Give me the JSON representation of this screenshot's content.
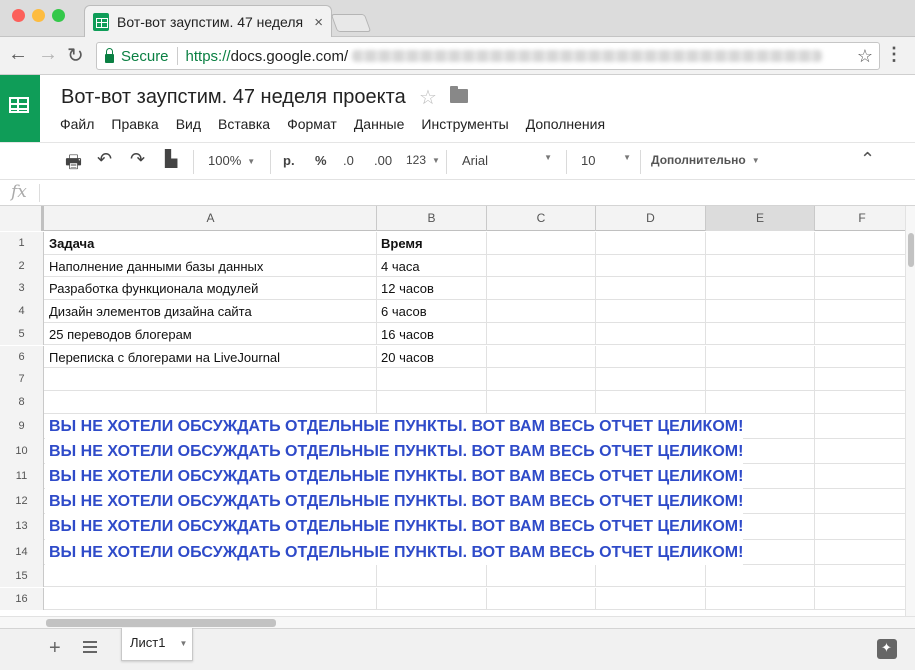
{
  "browser": {
    "tab_title": "Вот-вот заупстим. 47 неделя",
    "tab_close": "×",
    "secure_label": "Secure",
    "url_protocol": "https://",
    "url_host": "docs.google.com/"
  },
  "doc": {
    "title": "Вот-вот заупстим. 47 неделя проекта",
    "menu": [
      "Файл",
      "Правка",
      "Вид",
      "Вставка",
      "Формат",
      "Данные",
      "Инструменты",
      "Дополнения"
    ]
  },
  "toolbar": {
    "zoom": "100%",
    "currency": "р.",
    "percent": "%",
    "dec_decrease": ".0",
    "dec_increase": ".00",
    "more_formats": "123",
    "font": "Arial",
    "font_size": "10",
    "more": "Дополнительно"
  },
  "formula_bar": {
    "fx": "fx"
  },
  "columns": [
    "A",
    "B",
    "C",
    "D",
    "E",
    "F"
  ],
  "selected_column": "E",
  "rows": [
    {
      "n": "1",
      "a": "Задача",
      "b": "Время"
    },
    {
      "n": "2",
      "a": "Наполнение данными базы данных",
      "b": "4 часа"
    },
    {
      "n": "3",
      "a": "Разработка функционала модулей",
      "b": "12 часов"
    },
    {
      "n": "4",
      "a": "Дизайн элементов дизайна сайта",
      "b": "6 часов"
    },
    {
      "n": "5",
      "a": "25 переводов блогерам",
      "b": "16 часов"
    },
    {
      "n": "6",
      "a": "Переписка с блогерами на LiveJournal",
      "b": "20 часов"
    },
    {
      "n": "7",
      "a": "",
      "b": ""
    },
    {
      "n": "8",
      "a": "",
      "b": ""
    },
    {
      "n": "9",
      "big": "ВЫ НЕ ХОТЕЛИ ОБСУЖДАТЬ ОТДЕЛЬНЫЕ ПУНКТЫ. ВОТ ВАМ ВЕСЬ ОТЧЕТ ЦЕЛИКОМ!"
    },
    {
      "n": "10",
      "big": "ВЫ НЕ ХОТЕЛИ ОБСУЖДАТЬ ОТДЕЛЬНЫЕ ПУНКТЫ. ВОТ ВАМ ВЕСЬ ОТЧЕТ ЦЕЛИКОМ!"
    },
    {
      "n": "11",
      "big": "ВЫ НЕ ХОТЕЛИ ОБСУЖДАТЬ ОТДЕЛЬНЫЕ ПУНКТЫ. ВОТ ВАМ ВЕСЬ ОТЧЕТ ЦЕЛИКОМ!"
    },
    {
      "n": "12",
      "big": "ВЫ НЕ ХОТЕЛИ ОБСУЖДАТЬ ОТДЕЛЬНЫЕ ПУНКТЫ. ВОТ ВАМ ВЕСЬ ОТЧЕТ ЦЕЛИКОМ!"
    },
    {
      "n": "13",
      "big": "ВЫ НЕ ХОТЕЛИ ОБСУЖДАТЬ ОТДЕЛЬНЫЕ ПУНКТЫ. ВОТ ВАМ ВЕСЬ ОТЧЕТ ЦЕЛИКОМ!"
    },
    {
      "n": "14",
      "big": "ВЫ НЕ ХОТЕЛИ ОБСУЖДАТЬ ОТДЕЛЬНЫЕ ПУНКТЫ. ВОТ ВАМ ВЕСЬ ОТЧЕТ ЦЕЛИКОМ!"
    },
    {
      "n": "15",
      "a": "",
      "b": ""
    },
    {
      "n": "16",
      "a": "",
      "b": ""
    }
  ],
  "sheets": {
    "active": "Лист1"
  },
  "colors": {
    "accent_green": "#0f9d58",
    "shout_text": "#2f4bc9",
    "secure_green": "#0b8043"
  }
}
